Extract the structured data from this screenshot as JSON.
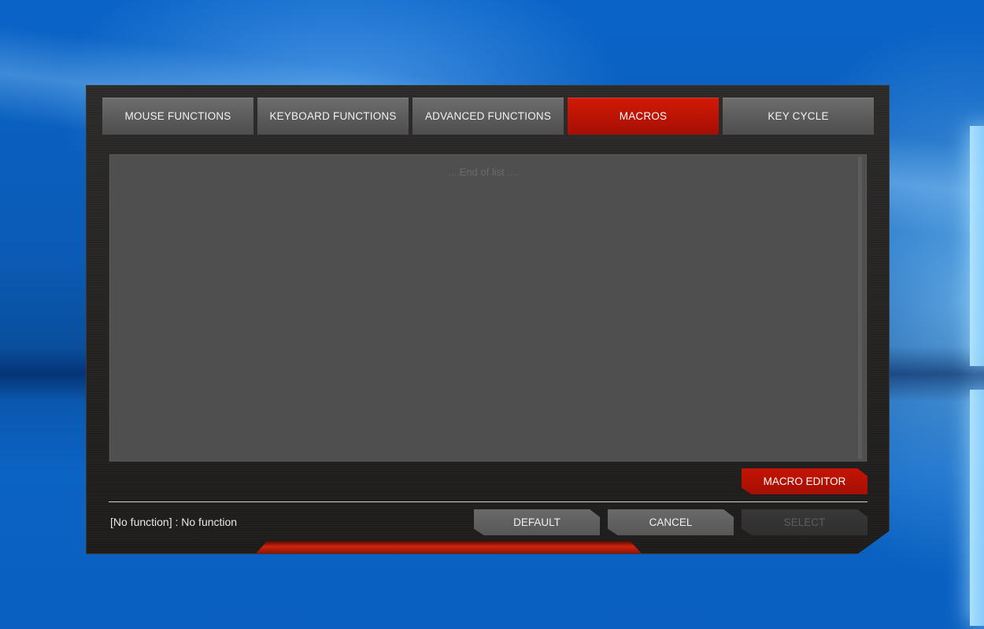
{
  "tabs": [
    {
      "label": "MOUSE FUNCTIONS",
      "active": false
    },
    {
      "label": "KEYBOARD FUNCTIONS",
      "active": false
    },
    {
      "label": "ADVANCED FUNCTIONS",
      "active": false
    },
    {
      "label": "MACROS",
      "active": true
    },
    {
      "label": "KEY CYCLE",
      "active": false
    }
  ],
  "list": {
    "end_text": "....End of list ...."
  },
  "buttons": {
    "macro_editor": "MACRO EDITOR",
    "default": "DEFAULT",
    "cancel": "CANCEL",
    "select": "SELECT"
  },
  "status": {
    "text": "[No function] : No function"
  },
  "colors": {
    "accent": "#c41405",
    "tab_inactive": "#5b5b5b",
    "panel": "#4f4f4f",
    "desktop": "#0b5bb6"
  }
}
